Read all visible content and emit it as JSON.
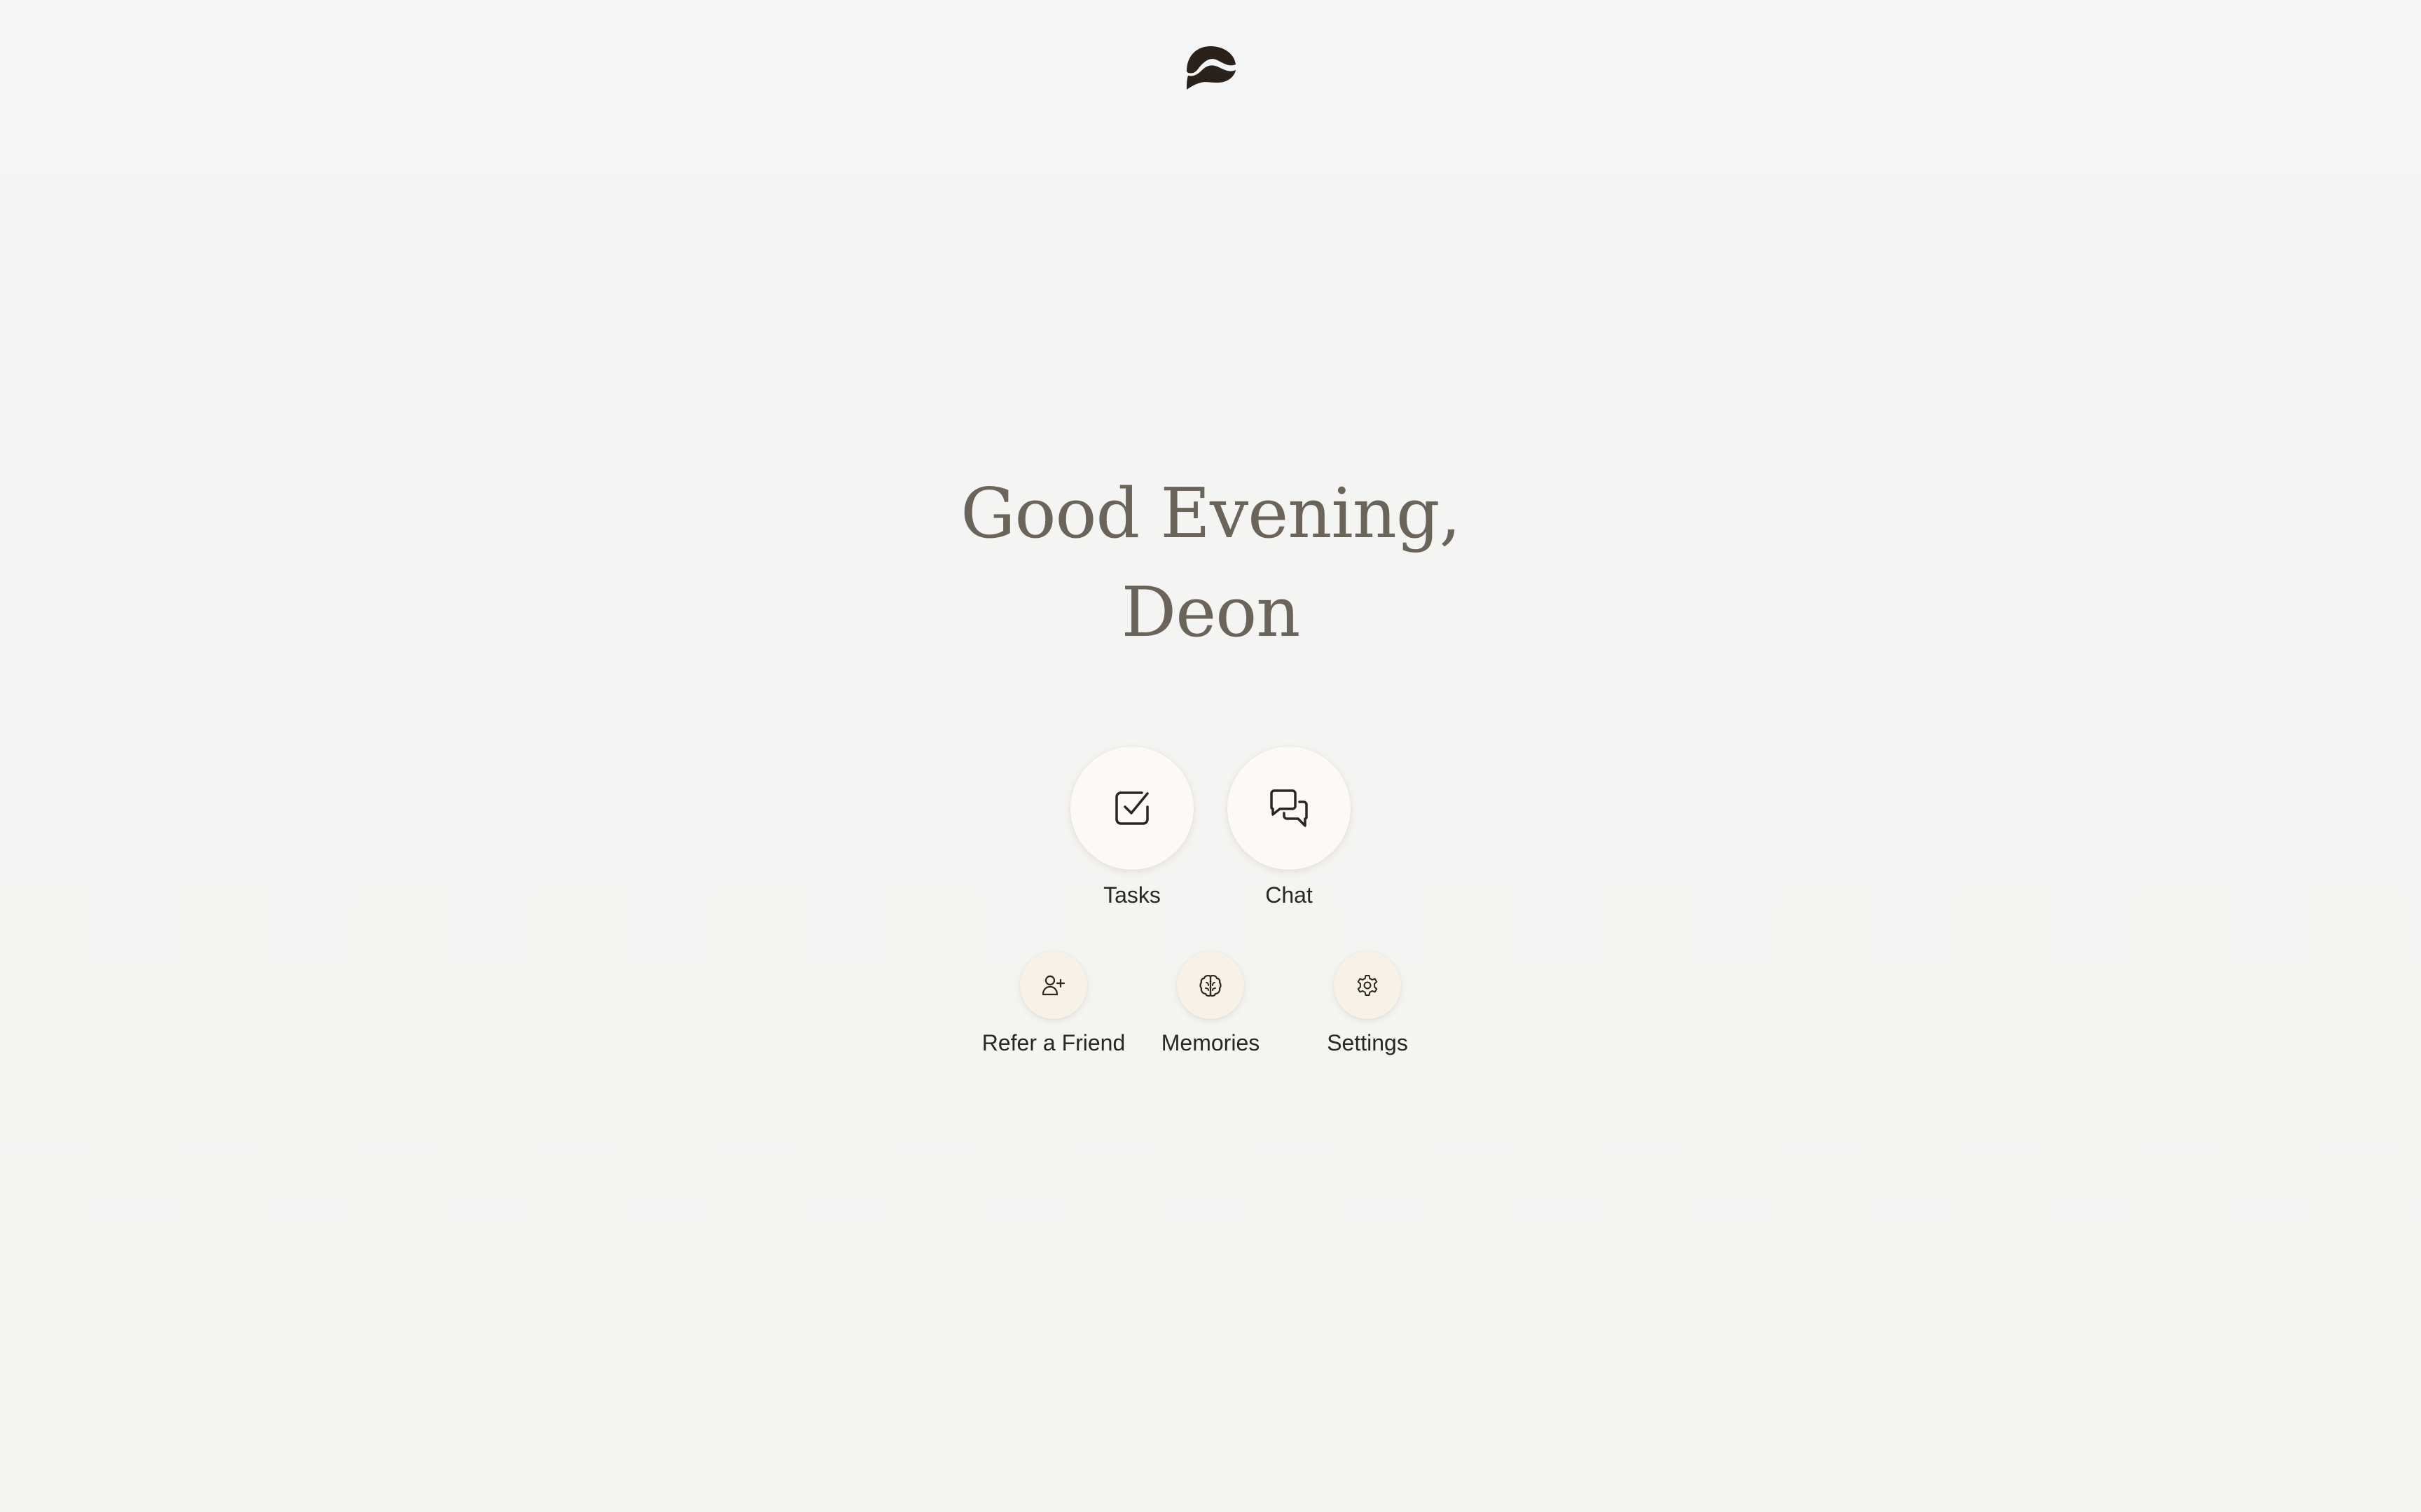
{
  "greeting": {
    "line1": "Good Evening,",
    "line2": "Deon"
  },
  "primary_actions": [
    {
      "label": "Tasks",
      "icon": "checkbox-icon"
    },
    {
      "label": "Chat",
      "icon": "chat-bubbles-icon"
    }
  ],
  "secondary_actions": [
    {
      "label": "Refer a Friend",
      "icon": "user-plus-icon"
    },
    {
      "label": "Memories",
      "icon": "brain-icon"
    },
    {
      "label": "Settings",
      "icon": "gear-icon"
    }
  ],
  "colors": {
    "greeting_text": "#6b645b",
    "label_text": "#2a2723",
    "logo": "#2b211b",
    "primary_circle": "#fdf9f4",
    "secondary_circle": "#f8f1e6"
  }
}
